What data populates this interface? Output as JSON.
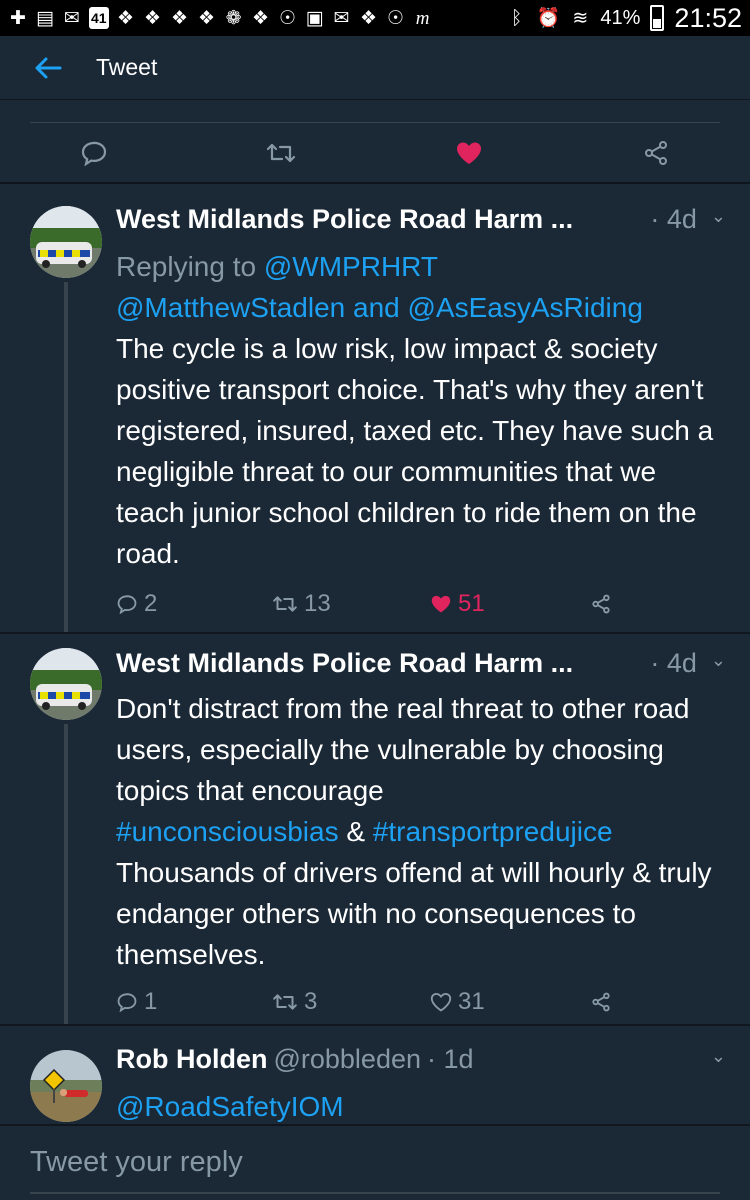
{
  "status_bar": {
    "notification_badge": "41",
    "battery_percent": "41%",
    "battery_level": 0.41,
    "time": "21:52",
    "left_icons": [
      "add-icon",
      "notes-icon",
      "mail-icon",
      "youtube-icon",
      "twitter-icon",
      "twitter-icon",
      "twitter-icon",
      "twitter-icon",
      "flower-icon",
      "twitter-icon",
      "podcast-icon",
      "gallery-icon",
      "gmail-icon",
      "twitter-icon",
      "podcast-icon",
      "m-icon"
    ],
    "m_label": "m"
  },
  "header": {
    "title": "Tweet",
    "back_icon": "back-arrow-icon"
  },
  "colors": {
    "background": "#1b2836",
    "accent": "#1da1f2",
    "like": "#e0245e",
    "muted": "#8899a6"
  },
  "tweets": [
    {
      "name": "West Midlands Police Road Harm ...",
      "time": "· 4d",
      "replying_prefix": "Replying to ",
      "replying_to": "@WMPRHRT",
      "mention_1": "@MatthewStadlen",
      "mention_and": " and ",
      "mention_2": "@AsEasyAsRiding",
      "text": "The cycle is a low risk, low impact & society positive transport choice. That's why they aren't registered, insured, taxed etc. They have such a negligible threat to our communities that we teach junior school children to ride them on the road.",
      "replies": "2",
      "retweets": "13",
      "likes": "51"
    },
    {
      "name": "West Midlands Police Road Harm ...",
      "time": "· 4d",
      "text_1": "Don't distract from the real threat to other road users, especially the vulnerable by choosing topics that encourage",
      "hashtag_1": "#unconsciousbias",
      "amp": " & ",
      "hashtag_2": "#transportpredujice",
      "text_2": "Thousands of drivers offend at will hourly & truly endanger others with no consequences to themselves.",
      "replies": "1",
      "retweets": "3",
      "likes": "31"
    },
    {
      "name": "Rob Holden",
      "handle": "@robbleden",
      "time": "· 1d",
      "mention": "@RoadSafetyIOM"
    }
  ],
  "reply_box": {
    "placeholder": "Tweet your reply"
  }
}
